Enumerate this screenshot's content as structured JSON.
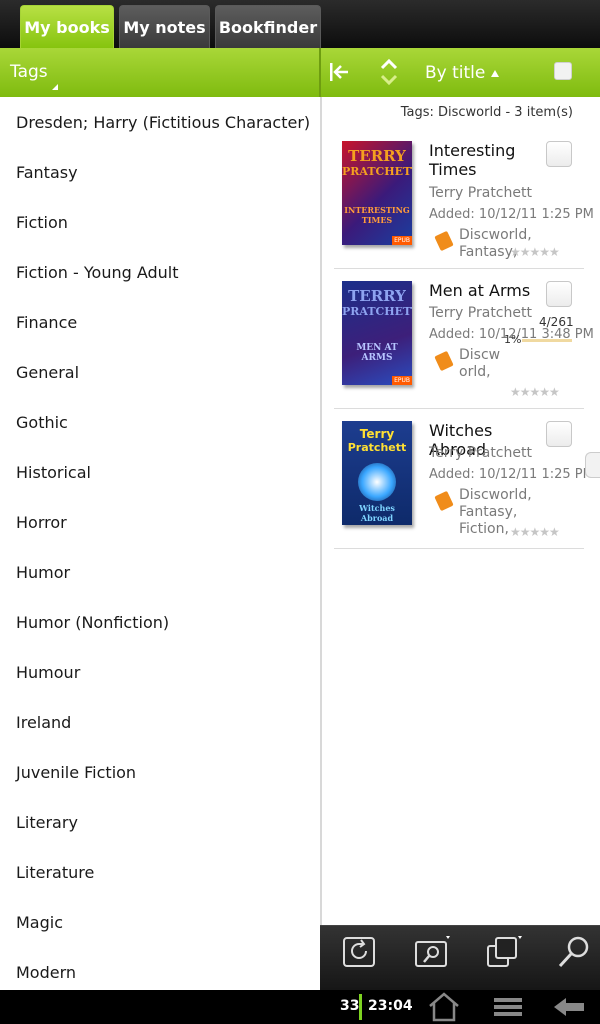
{
  "tabs": [
    {
      "label": "My books",
      "active": true
    },
    {
      "label": "My notes",
      "active": false
    },
    {
      "label": "Bookfinder",
      "active": false
    }
  ],
  "toolbar": {
    "tags_label": "Tags",
    "sort_label": "By title"
  },
  "tags": [
    "Dresden; Harry (Fictitious Character)",
    "Fantasy",
    "Fiction",
    "Fiction - Young Adult",
    "Finance",
    "General",
    "Gothic",
    "Historical",
    "Horror",
    "Humor",
    "Humor (Nonfiction)",
    "Humour",
    "Ireland",
    "Juvenile Fiction",
    "Literary",
    "Literature",
    "Magic",
    "Modern"
  ],
  "summary": "Tags: Discworld - 3 item(s)",
  "books": [
    {
      "title": "Interesting Times",
      "author": "Terry Pratchett",
      "added": "Added: 10/12/11 1:25 PM",
      "tags": "Discworld, Fantasy, Fiction,",
      "rating": 0
    },
    {
      "title": "Men at Arms",
      "author": "Terry Pratchett",
      "added": "Added: 10/12/11 3:48 PM",
      "tags": "Discw orld,",
      "progress_page": "4/261",
      "progress_pct": "1%",
      "rating": 0
    },
    {
      "title": "Witches Abroad",
      "author": "Terry Pratchett",
      "added": "Added: 10/12/11 1:25 PM",
      "tags": "Discworld, Fantasy, Fiction,",
      "rating": 0
    }
  ],
  "covers": [
    {
      "top": "TERRY",
      "mid": "PRATCHETT",
      "bottom": "INTERESTING TIMES",
      "badge": "EPUB"
    },
    {
      "top": "TERRY",
      "mid": "PRATCHETT",
      "bottom": "MEN AT ARMS",
      "badge": "EPUB"
    },
    {
      "top": "Terry",
      "mid": "Pratchett",
      "bottom": "Witches Abroad",
      "badge": ""
    }
  ],
  "status": {
    "battery": "33",
    "time": "23:04"
  },
  "colors": {
    "accent_green": "#8cc514",
    "tag_orange": "#f08c1a"
  }
}
